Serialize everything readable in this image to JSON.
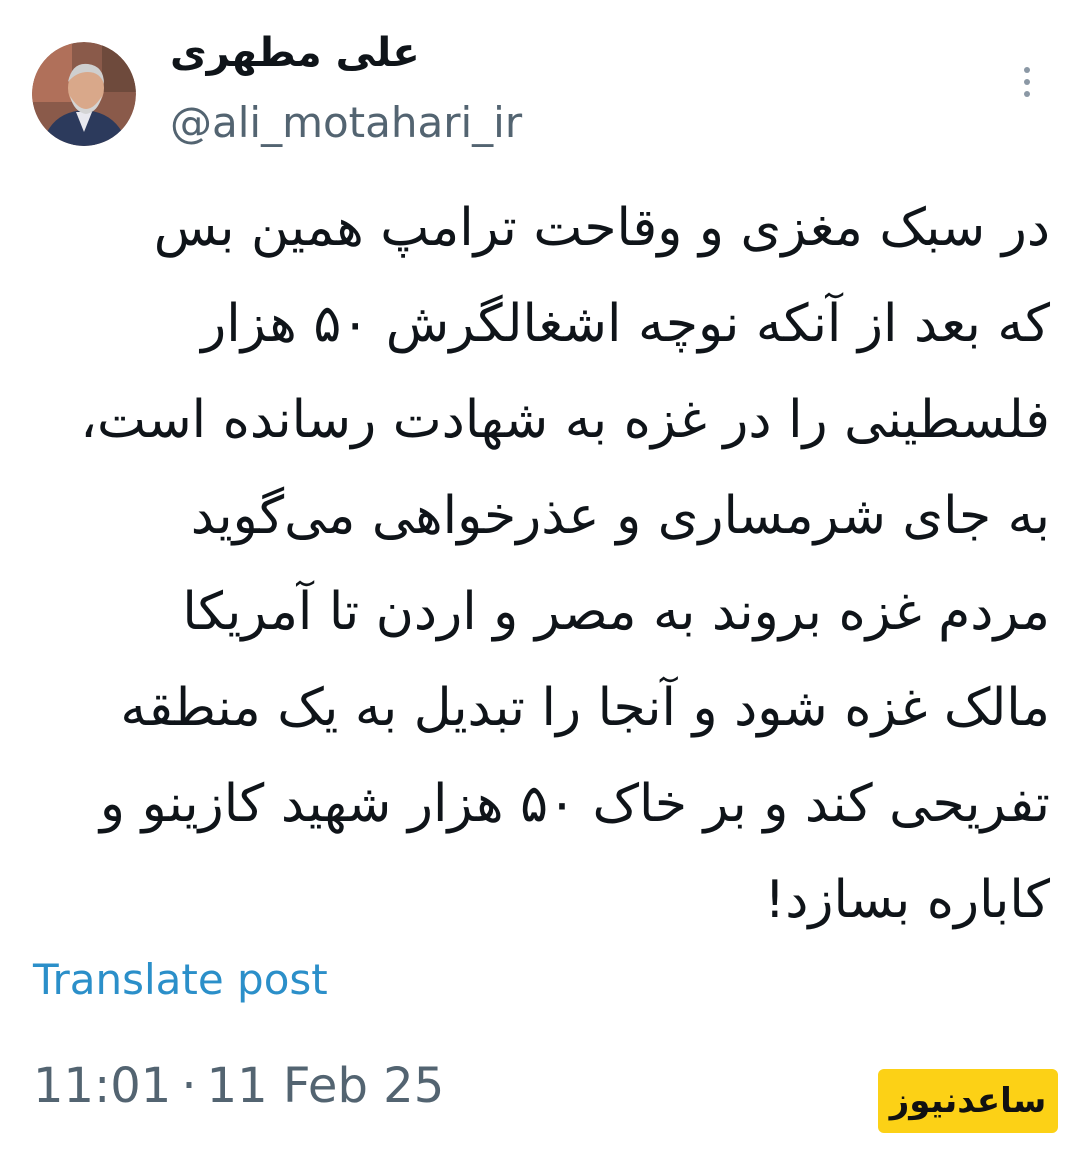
{
  "author": {
    "display_name": "علی مطهری",
    "handle": "@ali_motahari_ir",
    "avatar_icon": "person-portrait"
  },
  "tweet": {
    "lines": [
      "در سبک مغزی و وقاحت ترامپ همین بس",
      "که بعد از آنکه نوچه اشغالگرش ۵۰ هزار",
      "فلسطینی را در غزه به شهادت رسانده است،",
      "به جای شرمساری و عذرخواهی می‌گوید",
      "مردم غزه بروند به مصر و اردن تا آمریکا",
      "مالک غزه شود و آنجا را تبدیل به یک منطقه",
      "تفریحی کند و بر خاک ۵۰ هزار شهید کازینو و",
      "کاباره بسازد!"
    ]
  },
  "actions": {
    "translate_label": "Translate post"
  },
  "meta": {
    "time": "11:01",
    "separator": "·",
    "date": "11 Feb 25"
  },
  "watermark": {
    "text": "ساعدنیوز",
    "color": "#fcd116"
  },
  "colors": {
    "link": "#2b8fc9",
    "secondary_text": "#536471",
    "primary_text": "#0f1419"
  }
}
